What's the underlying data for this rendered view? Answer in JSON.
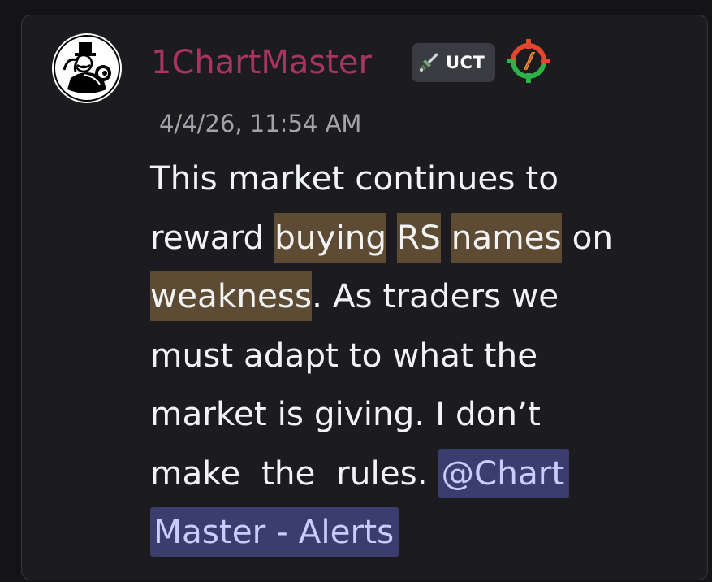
{
  "message": {
    "author": "1ChartMaster",
    "role_tag": "UCT",
    "timestamp": "4/4/26, 11:54 AM",
    "lines": [
      [
        "This market continues to"
      ],
      [
        "reward ",
        "buying",
        " ",
        "RS",
        " ",
        "names",
        " on"
      ],
      [
        "weakness",
        ". As traders we"
      ],
      [
        "must adapt to what the"
      ],
      [
        "market is giving. I don’t"
      ],
      [
        "make  the  rules. ",
        "@Chart"
      ],
      [
        "Master - Alerts"
      ]
    ]
  },
  "colors": {
    "username": "#a8355f",
    "highlight": "#5d4b33",
    "mention_bg": "#3a3d6e",
    "mention_text": "#c9cdfb"
  },
  "icons": {
    "avatar": "cartoon-mascot-avatar",
    "tag_icon": "sword-icon",
    "badge": "crosshair-target-icon"
  }
}
